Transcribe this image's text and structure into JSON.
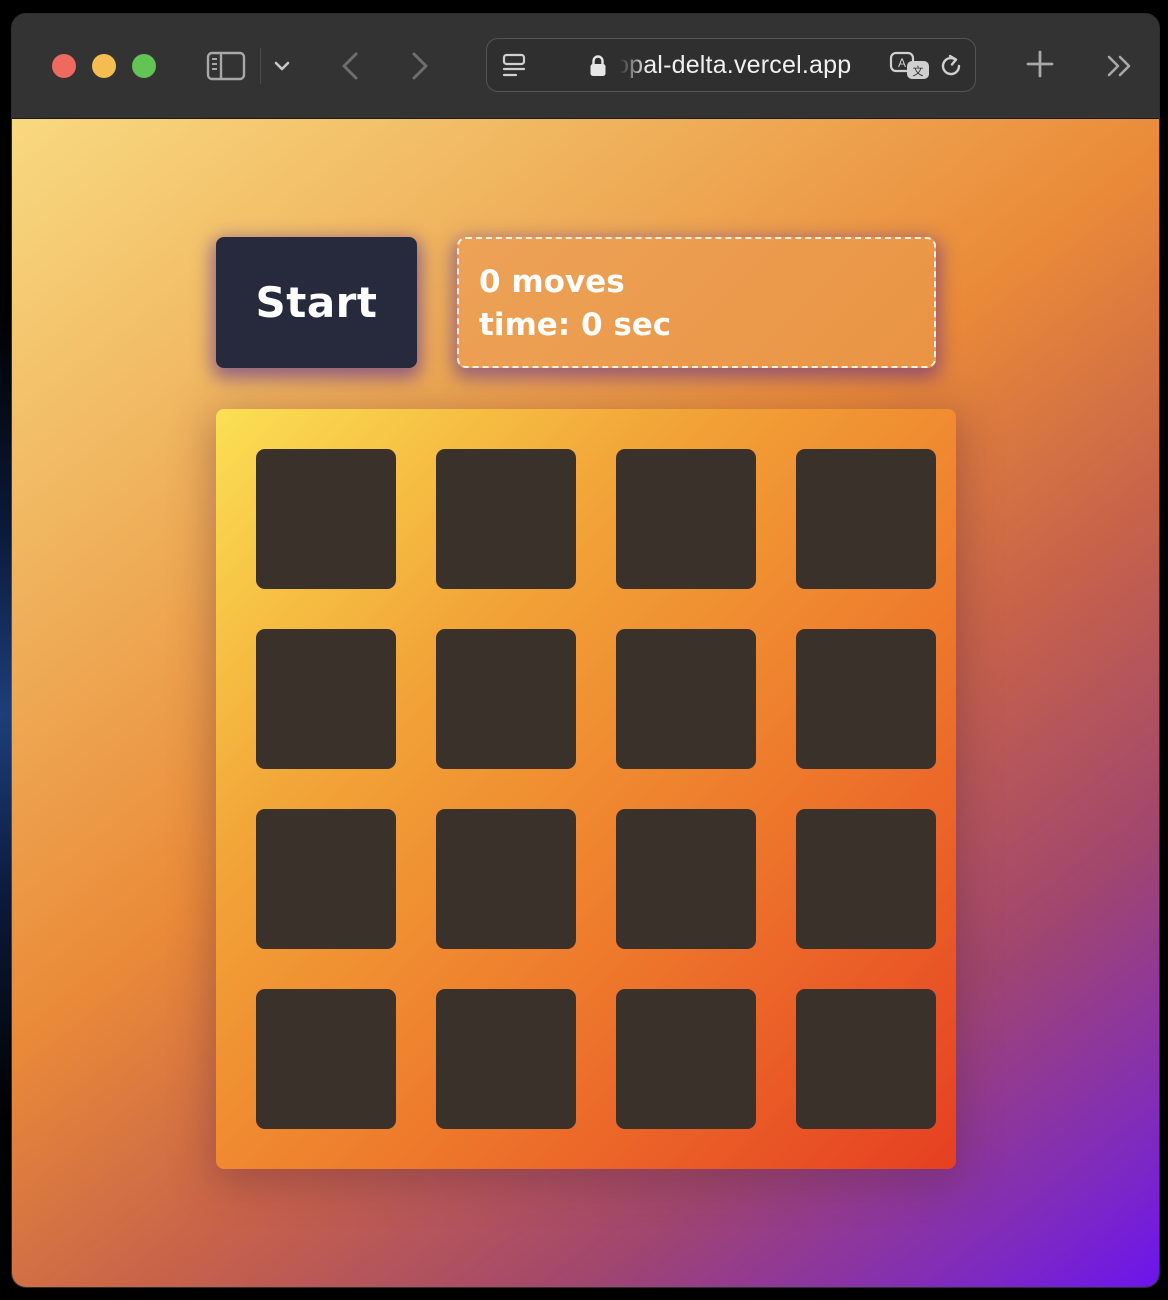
{
  "browser": {
    "url": "opal-delta.vercel.app",
    "icons": {
      "sidebar": "sidebar-icon",
      "tab_menu": "chevron-down-icon",
      "back": "chevron-left-icon",
      "forward": "chevron-right-icon",
      "reader": "reader-icon",
      "lock": "lock-icon",
      "translate": "translate-icon",
      "reload": "reload-icon",
      "new_tab": "plus-icon",
      "more": "double-chevron-right-icon"
    }
  },
  "game": {
    "start_label": "Start",
    "moves_text": "0 moves",
    "time_text": "time: 0 sec",
    "cards": [
      {
        "state": "face-down"
      },
      {
        "state": "face-down"
      },
      {
        "state": "face-down"
      },
      {
        "state": "face-down"
      },
      {
        "state": "face-down"
      },
      {
        "state": "face-down"
      },
      {
        "state": "face-down"
      },
      {
        "state": "face-down"
      },
      {
        "state": "face-down"
      },
      {
        "state": "face-down"
      },
      {
        "state": "face-down"
      },
      {
        "state": "face-down"
      },
      {
        "state": "face-down"
      },
      {
        "state": "face-down"
      },
      {
        "state": "face-down"
      },
      {
        "state": "face-down"
      }
    ]
  },
  "colors": {
    "start_button": "#272a3c",
    "card_back": "#3a312b"
  }
}
